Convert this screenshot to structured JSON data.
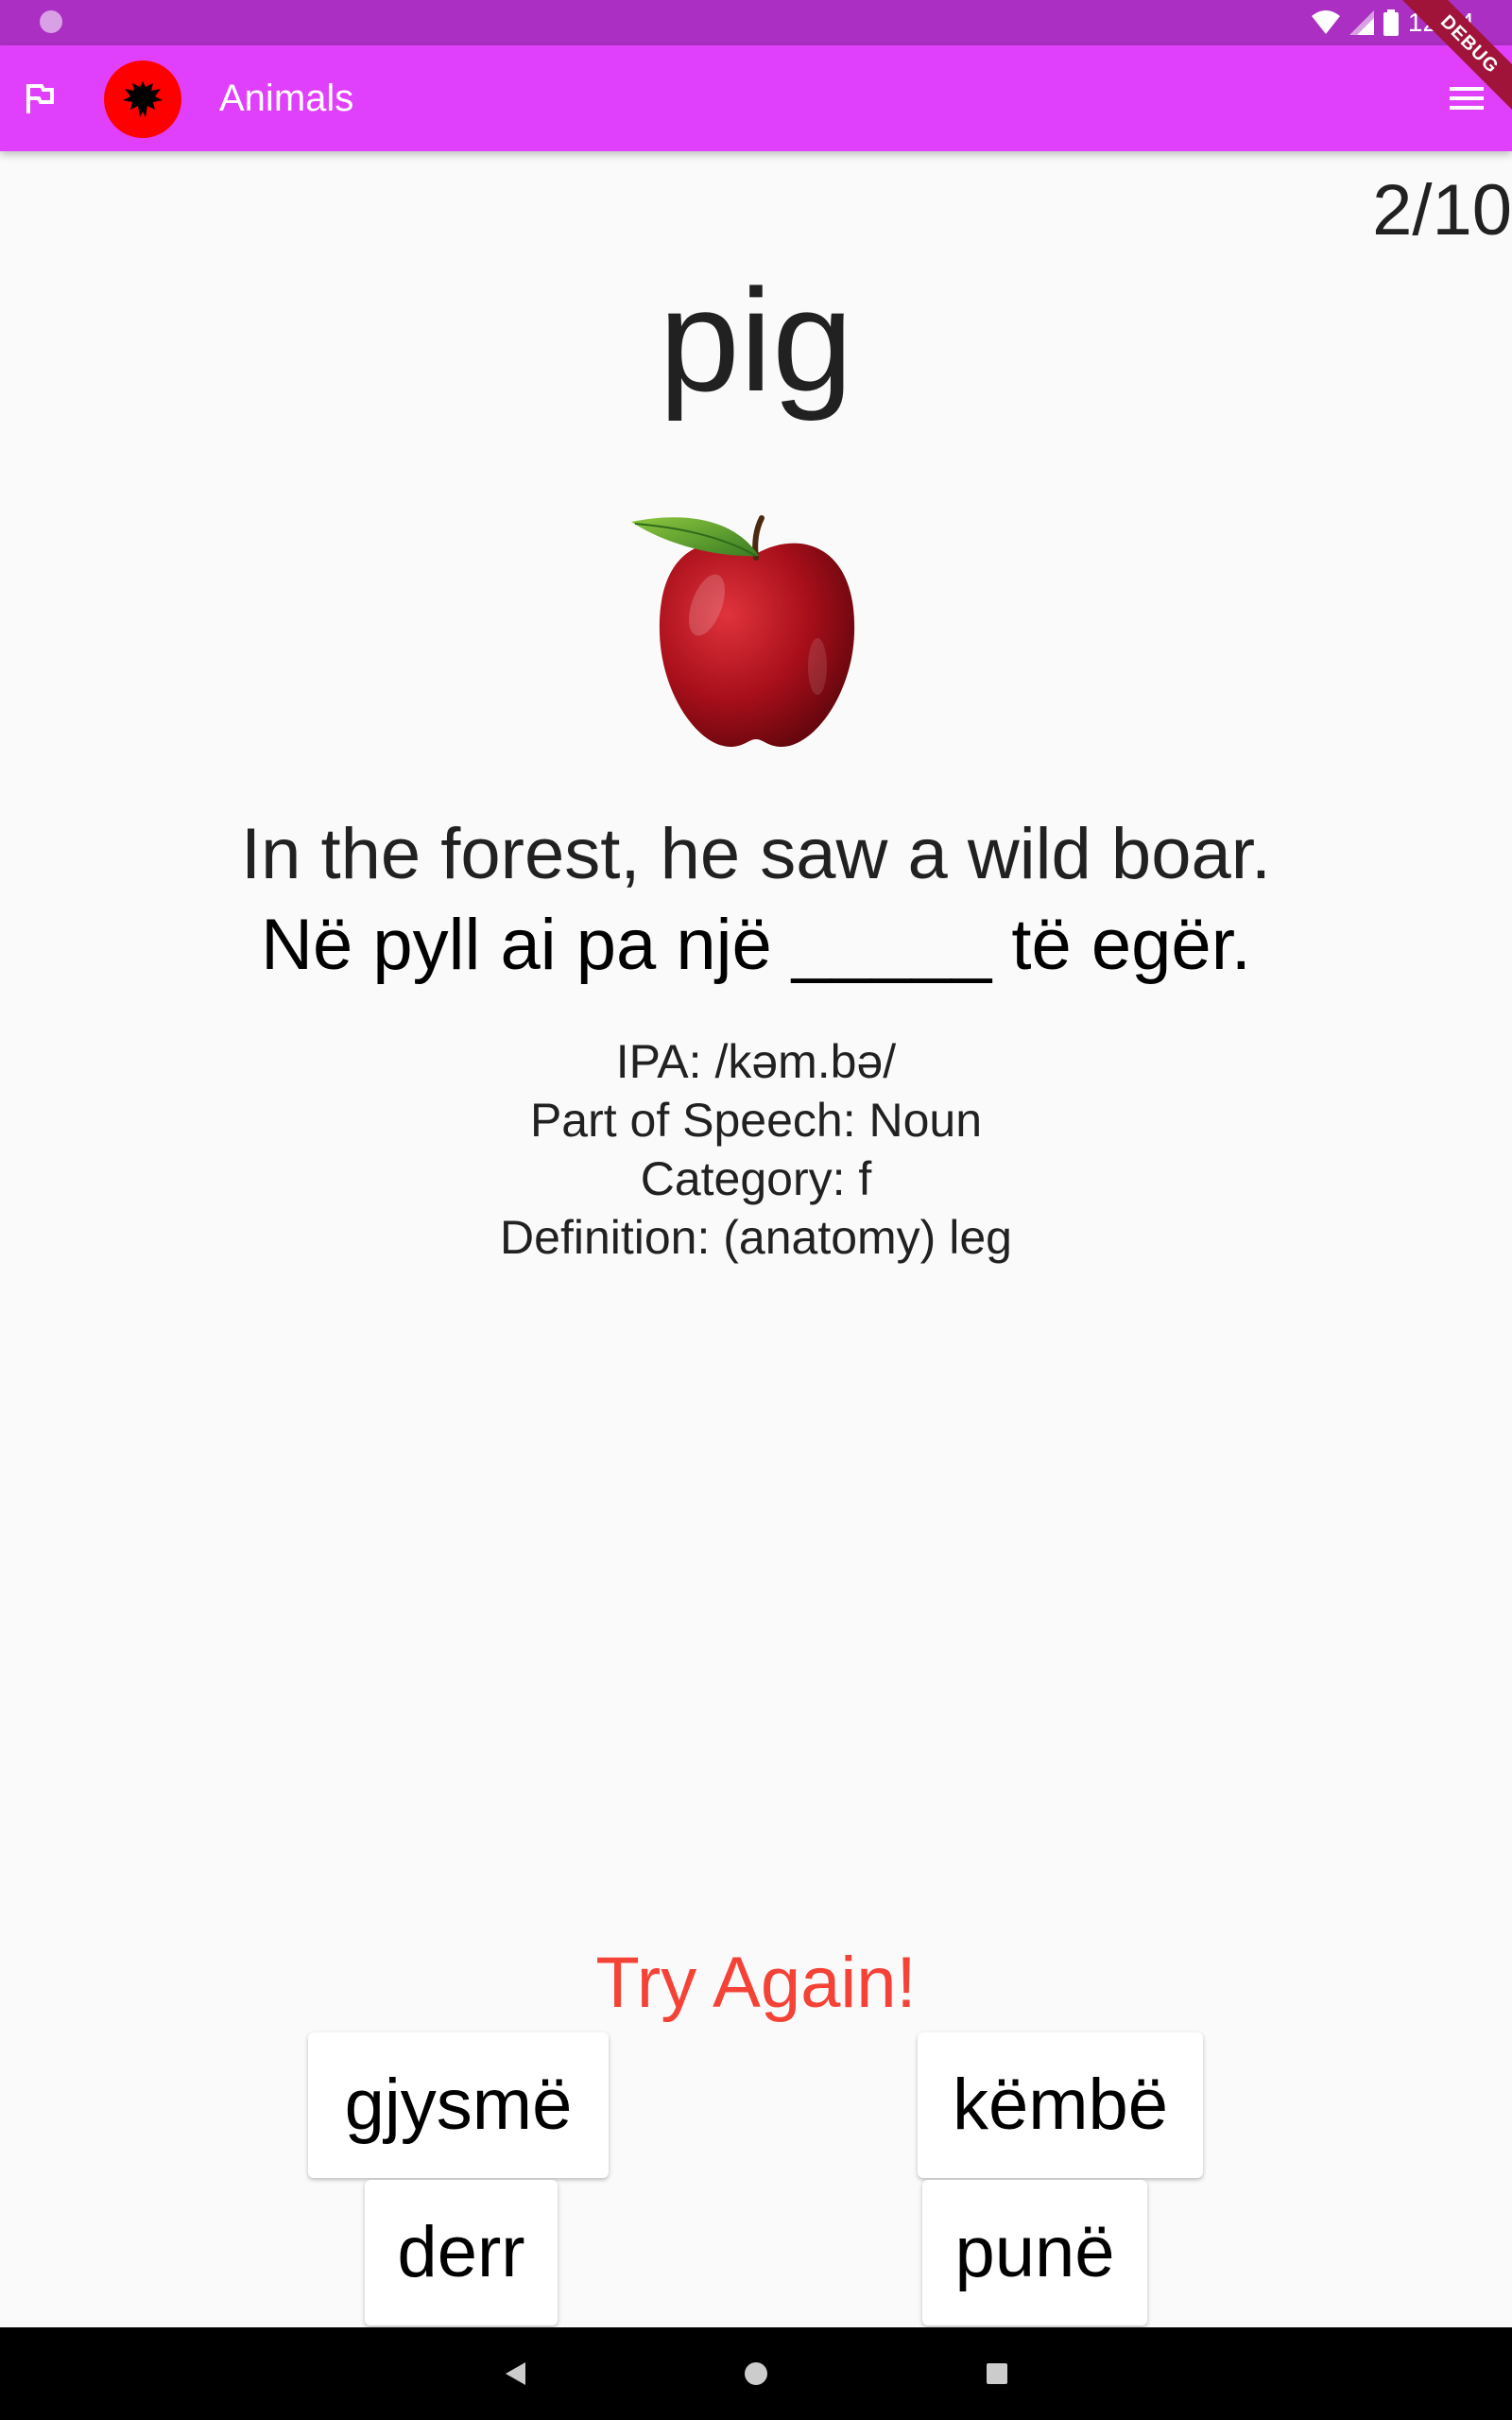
{
  "status_bar": {
    "time": "12:14",
    "color": "#aa2fc2"
  },
  "debug_banner": "DEBUG",
  "app_bar": {
    "title": "Animals",
    "color": "#e040fb",
    "avatar_color": "#ff0000",
    "icons": [
      "flag-icon",
      "albania-eagle-icon",
      "menu-icon"
    ]
  },
  "quiz": {
    "progress": "2/10",
    "word": "pig",
    "image": "red-apple",
    "sentence_english": "In the forest, he saw a wild boar.",
    "sentence_albanian": "Në pyll ai pa një _____ të egër.",
    "details": {
      "ipa": "IPA: /kəm.bə/",
      "part_of_speech": "Part of Speech: Noun",
      "category": "Category: f",
      "definition": "Definition: (anatomy) leg"
    },
    "feedback": "Try Again!",
    "feedback_color": "#f44336",
    "choices": [
      "gjysmë",
      "këmbë",
      "derr",
      "punë"
    ]
  },
  "nav_bar": {
    "icons": [
      "back-triangle-icon",
      "home-circle-icon",
      "recents-square-icon"
    ]
  }
}
